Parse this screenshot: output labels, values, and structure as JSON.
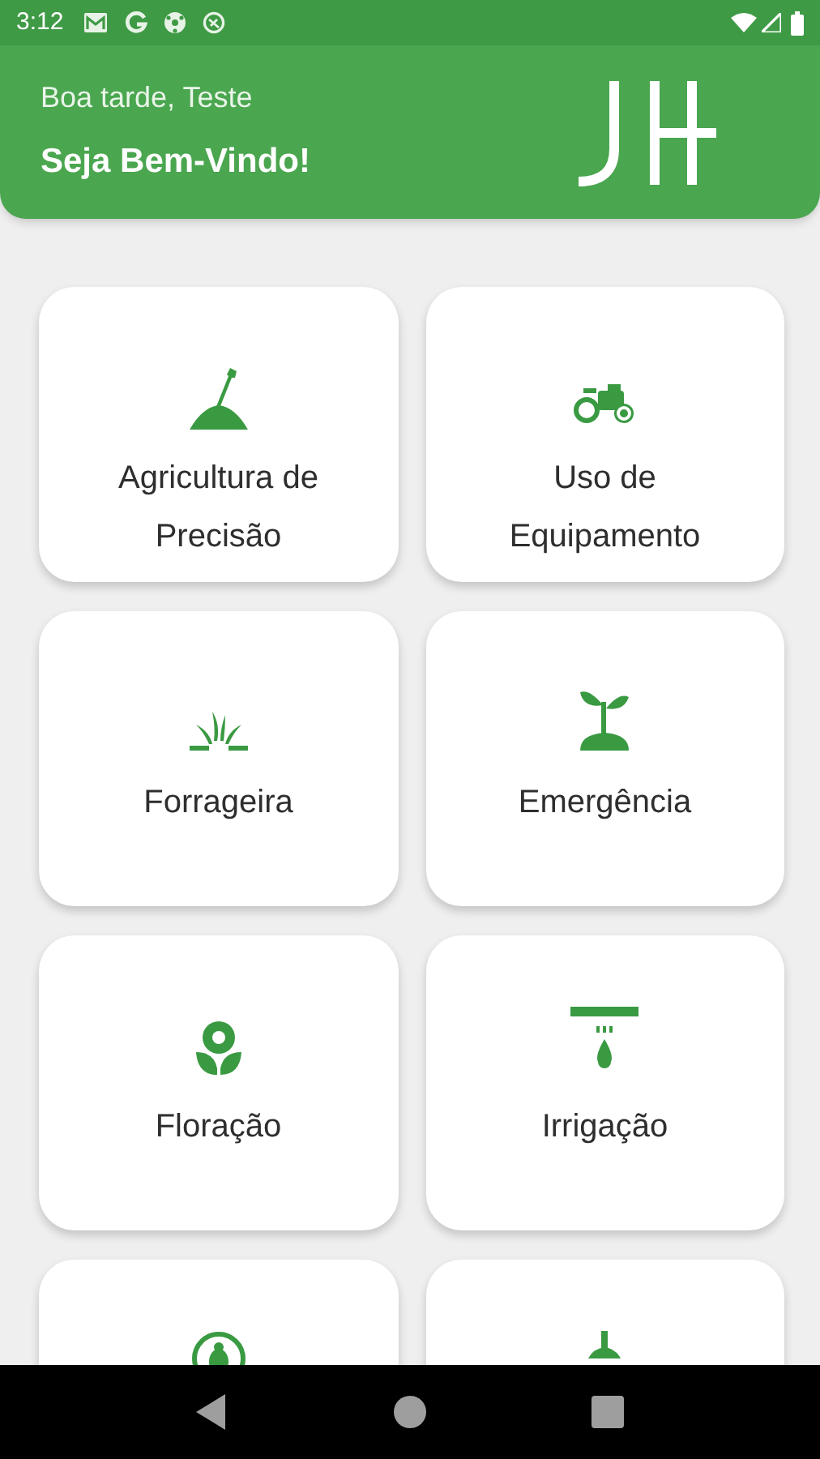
{
  "status_bar": {
    "time": "3:12"
  },
  "header": {
    "greeting": "Boa tarde, Teste",
    "welcome": "Seja Bem-Vindo!"
  },
  "cards": [
    {
      "kind": "full",
      "label": "Agricultura de Precisão"
    },
    {
      "kind": "full",
      "label": "Uso de Equipamento"
    },
    {
      "kind": "full",
      "label": "Forrageira"
    },
    {
      "kind": "full",
      "label": "Emergência"
    },
    {
      "kind": "full",
      "label": "Floração"
    },
    {
      "kind": "full",
      "label": "Irrigação"
    },
    {
      "kind": "cut_off"
    },
    {
      "kind": "cut_off"
    }
  ]
}
